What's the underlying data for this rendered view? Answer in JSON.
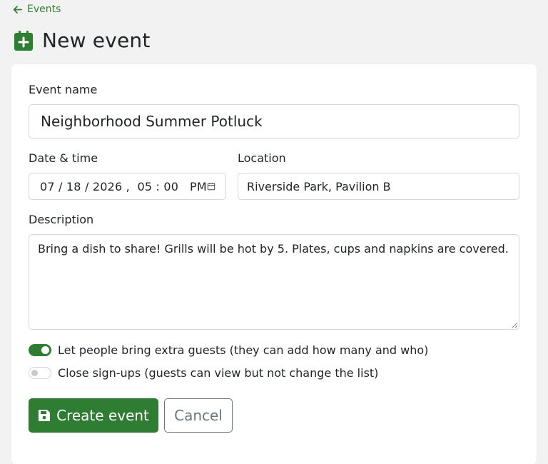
{
  "nav": {
    "back_label": "Events"
  },
  "header": {
    "title": "New event"
  },
  "form": {
    "event_name": {
      "label": "Event name",
      "value": "Neighborhood Summer Potluck"
    },
    "datetime": {
      "label": "Date & time",
      "value": "07 / 18 / 2026 ,  05 : 00   PM"
    },
    "location": {
      "label": "Location",
      "value": "Riverside Park, Pavilion B"
    },
    "description": {
      "label": "Description",
      "value": "Bring a dish to share! Grills will be hot by 5. Plates, cups and napkins are covered."
    },
    "toggles": [
      {
        "label": "Let people bring extra guests (they can add how many and who)",
        "checked": true
      },
      {
        "label": "Close sign-ups (guests can view but not change the list)",
        "checked": false
      }
    ],
    "submit_label": "Create event",
    "cancel_label": "Cancel"
  },
  "colors": {
    "accent": "#2e7d32",
    "page_bg": "#f2f2f2",
    "border": "#d3d6da"
  }
}
